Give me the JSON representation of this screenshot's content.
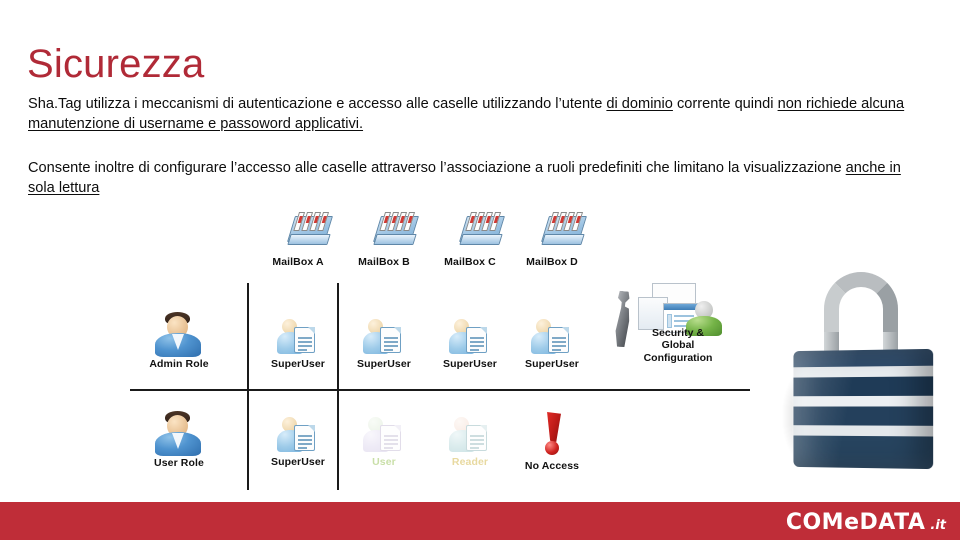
{
  "slide": {
    "title": "Sicurezza",
    "title_color": "#b02a37",
    "paragraphs": [
      {
        "id": "p1",
        "segments": [
          {
            "text": "Sha.Tag utilizza i meccanismi di autenticazione e accesso alle caselle utilizzando l’utente ",
            "underline": false
          },
          {
            "text": "di dominio",
            "underline": true
          },
          {
            "text": " corrente quindi ",
            "underline": false
          },
          {
            "text": "non richiede alcuna manutenzione di username e passoword applicativi.",
            "underline": true
          }
        ]
      },
      {
        "id": "p2",
        "segments": [
          {
            "text": "Consente inoltre di configurare l’accesso alle caselle attraverso l’associazione a ruoli predefiniti che limitano la visualizzazione ",
            "underline": false
          },
          {
            "text": "anche in sola lettura",
            "underline": true
          }
        ]
      }
    ]
  },
  "diagram": {
    "mailboxes": [
      {
        "label": "MailBox A",
        "icon": "mailbox-icon"
      },
      {
        "label": "MailBox B",
        "icon": "mailbox-icon"
      },
      {
        "label": "MailBox C",
        "icon": "mailbox-icon"
      },
      {
        "label": "MailBox D",
        "icon": "mailbox-icon"
      }
    ],
    "roles": [
      {
        "label": "Admin Role",
        "icon": "person-icon"
      },
      {
        "label": "User Role",
        "icon": "person-icon"
      }
    ],
    "matrix": [
      {
        "role": "Admin Role",
        "own_cell": {
          "label": "SuperUser",
          "icon": "user-card-icon",
          "state": "full"
        },
        "cells": [
          {
            "label": "SuperUser",
            "icon": "user-card-icon",
            "state": "full"
          },
          {
            "label": "SuperUser",
            "icon": "user-card-icon",
            "state": "full"
          },
          {
            "label": "SuperUser",
            "icon": "user-card-icon",
            "state": "full"
          }
        ]
      },
      {
        "role": "User Role",
        "own_cell": {
          "label": "SuperUser",
          "icon": "user-card-icon",
          "state": "full"
        },
        "cells": [
          {
            "label": "User",
            "icon": "user-card-icon",
            "state": "green"
          },
          {
            "label": "Reader",
            "icon": "user-card-icon",
            "state": "tan"
          },
          {
            "label": "No Access",
            "icon": "no-access-icon",
            "state": "denied"
          }
        ]
      }
    ],
    "security_config": {
      "label": "Security & Global Configuration",
      "lines": [
        "Security &",
        "Global",
        "Configuration"
      ],
      "icons": [
        "wrench-icon",
        "window-icon",
        "green-person-icon"
      ]
    },
    "padlock": {
      "icon": "padlock-icon",
      "body_color": "#27445f",
      "band_color": "#e8ecef"
    }
  },
  "footer": {
    "background": "#bf2d38",
    "logo": {
      "part1": "COM",
      "part2": "e",
      "part3": "DATA",
      "suffix": ".it"
    }
  }
}
